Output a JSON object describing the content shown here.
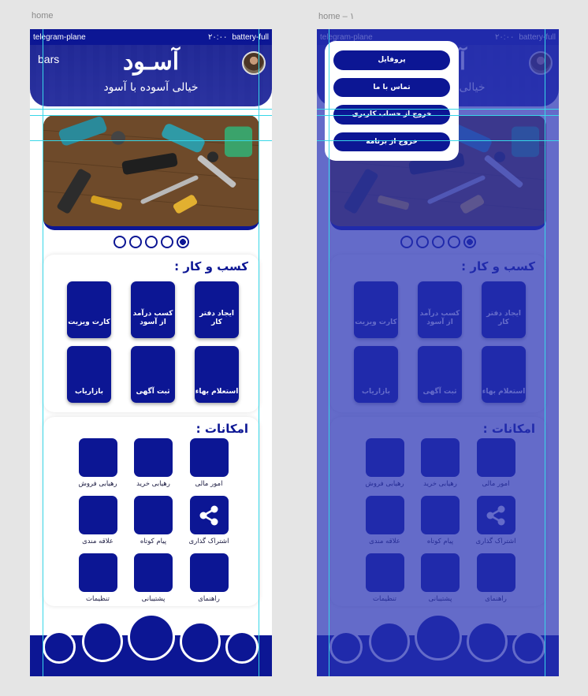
{
  "canvas": {
    "frame1_label": "home",
    "frame2_label": "home – ۱"
  },
  "status_bar": {
    "left": "telegram-plane",
    "time": "۲۰:۰۰",
    "right": "battery-full"
  },
  "header": {
    "menu_icon_text": "bars",
    "title": "آسـود",
    "subtitle": "خیالی آسوده با آسود"
  },
  "slider": {
    "count": 5,
    "active_index": 4
  },
  "business": {
    "title": "کسب و کار :",
    "cards": [
      "ایجاد دفتر کار",
      "کسب درآمد از آسود",
      "کارت ویزیت",
      "استعلام بهاء",
      "ثبت آگهی",
      "بازاریاب"
    ]
  },
  "facilities": {
    "title": "امکانات :",
    "items": [
      {
        "label": "امور مالی",
        "icon": "none"
      },
      {
        "label": "رهیابی خرید",
        "icon": "none"
      },
      {
        "label": "رهیابی فروش",
        "icon": "none"
      },
      {
        "label": "اشتراک گذاری",
        "icon": "share-icon"
      },
      {
        "label": "پیام کوتاه",
        "icon": "none"
      },
      {
        "label": "علاقه مندی",
        "icon": "none"
      },
      {
        "label": "راهنمای",
        "icon": "none"
      },
      {
        "label": "پشتیبانی",
        "icon": "none"
      },
      {
        "label": "تنظیمات",
        "icon": "none"
      }
    ]
  },
  "menu": {
    "items": [
      "پروفایل",
      "تماس با ما",
      "خروج از حساب کاربری",
      "خروج از برنامه"
    ]
  },
  "colors": {
    "primary": "#0c1694",
    "overlay": "#2832b4",
    "guide": "#37d7e8"
  }
}
